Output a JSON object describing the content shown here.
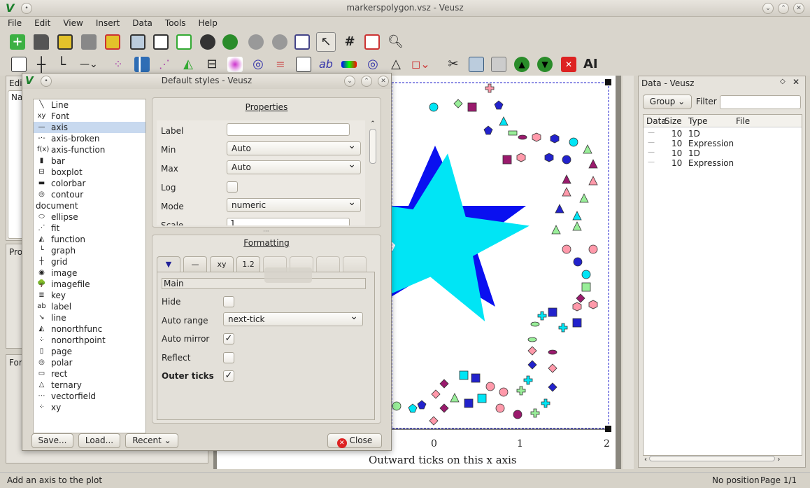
{
  "window": {
    "title": "markerspolygon.vsz - Veusz",
    "logo": "V"
  },
  "menu": [
    "File",
    "Edit",
    "View",
    "Insert",
    "Data",
    "Tools",
    "Help"
  ],
  "status": {
    "left": "Add an axis to the plot",
    "position": "No position",
    "page": "Page 1/1"
  },
  "dialog": {
    "title": "Default styles - Veusz",
    "widgets": [
      {
        "label": "Line",
        "icon": "line-icon",
        "glyph": "╲"
      },
      {
        "label": "Font",
        "icon": "font-icon",
        "glyph": "xy"
      },
      {
        "label": "axis",
        "icon": "axis-icon",
        "glyph": "—"
      },
      {
        "label": "axis-broken",
        "icon": "axis-broken-icon",
        "glyph": "-·-"
      },
      {
        "label": "axis-function",
        "icon": "axis-function-icon",
        "glyph": "f(x)"
      },
      {
        "label": "bar",
        "icon": "bar-icon",
        "glyph": "▮"
      },
      {
        "label": "boxplot",
        "icon": "boxplot-icon",
        "glyph": "⊟"
      },
      {
        "label": "colorbar",
        "icon": "colorbar-icon",
        "glyph": "▬"
      },
      {
        "label": "contour",
        "icon": "contour-icon",
        "glyph": "◎"
      },
      {
        "label": "document",
        "icon": "",
        "glyph": ""
      },
      {
        "label": "ellipse",
        "icon": "ellipse-icon",
        "glyph": "⬭"
      },
      {
        "label": "fit",
        "icon": "fit-icon",
        "glyph": "⋰"
      },
      {
        "label": "function",
        "icon": "function-icon",
        "glyph": "◭"
      },
      {
        "label": "graph",
        "icon": "graph-icon",
        "glyph": "└"
      },
      {
        "label": "grid",
        "icon": "grid-icon",
        "glyph": "┼"
      },
      {
        "label": "image",
        "icon": "image-icon",
        "glyph": "◉"
      },
      {
        "label": "imagefile",
        "icon": "imagefile-icon",
        "glyph": "🌳"
      },
      {
        "label": "key",
        "icon": "key-icon",
        "glyph": "≣"
      },
      {
        "label": "label",
        "icon": "label-icon",
        "glyph": "ab"
      },
      {
        "label": "line",
        "icon": "line-arrow-icon",
        "glyph": "↘"
      },
      {
        "label": "nonorthfunc",
        "icon": "nonorthfunc-icon",
        "glyph": "◭"
      },
      {
        "label": "nonorthpoint",
        "icon": "nonorthpoint-icon",
        "glyph": "⁘"
      },
      {
        "label": "page",
        "icon": "page-icon",
        "glyph": "▯"
      },
      {
        "label": "polar",
        "icon": "polar-icon",
        "glyph": "◎"
      },
      {
        "label": "rect",
        "icon": "rect-icon",
        "glyph": "▭"
      },
      {
        "label": "ternary",
        "icon": "ternary-icon",
        "glyph": "△"
      },
      {
        "label": "vectorfield",
        "icon": "vectorfield-icon",
        "glyph": "⋯"
      },
      {
        "label": "xy",
        "icon": "xy-icon",
        "glyph": "⁘"
      }
    ],
    "properties_title": "Properties",
    "properties": [
      {
        "label": "Label",
        "value": ""
      },
      {
        "label": "Min",
        "value": "Auto"
      },
      {
        "label": "Max",
        "value": "Auto"
      },
      {
        "label": "Log",
        "value": ""
      },
      {
        "label": "Mode",
        "value": "numeric"
      },
      {
        "label": "Scale",
        "value": "1"
      }
    ],
    "formatting_title": "Formatting",
    "tabs": [
      "▼",
      "—",
      "xy",
      "1.2",
      "",
      "",
      "",
      ""
    ],
    "section": "Main",
    "formatting": [
      {
        "label": "Hide",
        "checked": false
      },
      {
        "label": "Auto range",
        "value": "next-tick"
      },
      {
        "label": "Auto mirror",
        "checked": true
      },
      {
        "label": "Reflect",
        "checked": false
      },
      {
        "label": "Outer ticks",
        "checked": true
      }
    ],
    "buttons": {
      "save": "Save...",
      "load": "Load...",
      "recent": "Recent",
      "close": "Close"
    }
  },
  "left_panel": {
    "edit": "Edi",
    "name": "Na",
    "prop": "Pro",
    "fmt": "For"
  },
  "plot": {
    "xlabel": "Outward ticks on this x axis",
    "ticks": [
      "0",
      "1",
      "2"
    ]
  },
  "data_panel": {
    "title": "Data - Veusz",
    "group": "Group",
    "filter": "Filter",
    "columns": [
      "Data",
      "Size",
      "Type",
      "File"
    ],
    "rows": [
      [
        "",
        "10",
        "1D",
        ""
      ],
      [
        "",
        "10",
        "Expression",
        ""
      ],
      [
        "",
        "10",
        "1D",
        ""
      ],
      [
        "",
        "10",
        "Expression",
        ""
      ]
    ]
  },
  "colors": {
    "accent": "#00e5f5",
    "star_shadow": "#0a10f0",
    "select": "#c8d9ef"
  }
}
